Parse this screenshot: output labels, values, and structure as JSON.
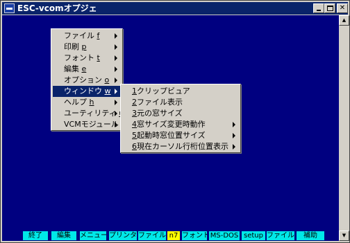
{
  "window": {
    "title": "ESC-vcomオプジェ"
  },
  "main_menu": {
    "items": [
      {
        "label": "ファイル",
        "key": "f"
      },
      {
        "label": "印刷",
        "key": "p"
      },
      {
        "label": "フォント",
        "key": "t"
      },
      {
        "label": "編集",
        "key": "e"
      },
      {
        "label": "オプション",
        "key": "o"
      },
      {
        "label": "ウィンドウ",
        "key": "w"
      },
      {
        "label": "ヘルプ",
        "key": "h"
      },
      {
        "label": "ユーティリティ",
        "key": "u"
      },
      {
        "label": "VCMモジュール",
        "key": ""
      }
    ],
    "selected_index": 5
  },
  "window_submenu": {
    "items": [
      {
        "num": "1",
        "label": "クリップビュア"
      },
      {
        "num": "2",
        "label": "ファイル表示"
      },
      {
        "num": "3",
        "label": "元の窓サイズ"
      },
      {
        "num": "4",
        "label": "窓サイズ変更時動作"
      },
      {
        "num": "5",
        "label": "起動時窓位置サイズ"
      },
      {
        "num": "6",
        "label": "現在カーソル行桁位置表示"
      }
    ]
  },
  "function_keys": [
    "終了",
    "編集",
    "メニュー",
    "プリンター",
    "ファイル受",
    "n7",
    "フォント",
    "MS-DOS",
    "setup",
    "ファイル送",
    "補助"
  ]
}
